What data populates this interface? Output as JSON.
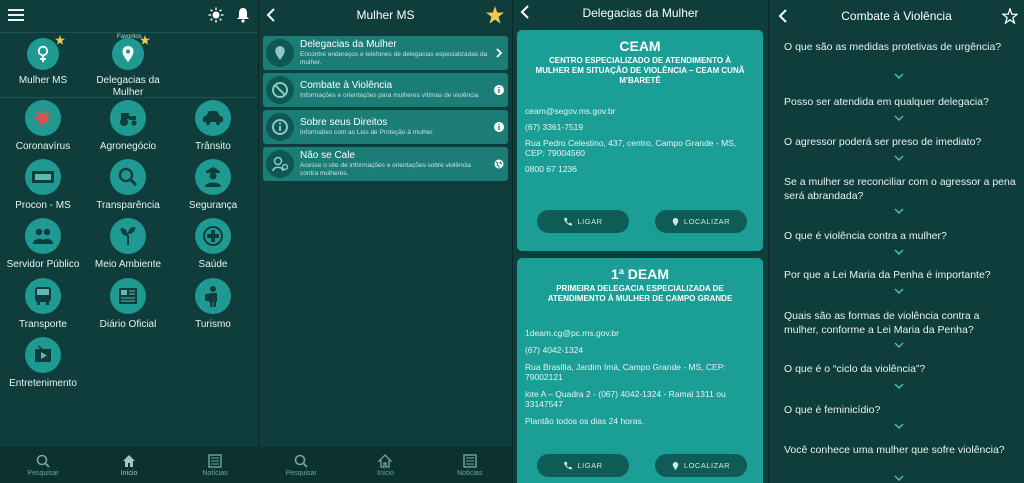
{
  "panel1": {
    "favorites_label": "Favoritos",
    "favorites": [
      {
        "label": "Mulher MS",
        "icon": "female-symbol-icon"
      },
      {
        "label": "Delegacias da Mulher",
        "icon": "location-pin-icon"
      }
    ],
    "tiles": [
      {
        "label": "Coronavírus",
        "icon": "virus-icon"
      },
      {
        "label": "Agronegócio",
        "icon": "tractor-icon"
      },
      {
        "label": "Trânsito",
        "icon": "car-icon"
      },
      {
        "label": "Procon - MS",
        "icon": "procon-icon"
      },
      {
        "label": "Transparência",
        "icon": "magnifier-icon"
      },
      {
        "label": "Segurança",
        "icon": "police-icon"
      },
      {
        "label": "Servidor Público",
        "icon": "people-icon"
      },
      {
        "label": "Meio Ambiente",
        "icon": "plant-icon"
      },
      {
        "label": "Saúde",
        "icon": "health-cross-icon"
      },
      {
        "label": "Transporte",
        "icon": "bus-icon"
      },
      {
        "label": "Diário Oficial",
        "icon": "newspaper-icon"
      },
      {
        "label": "Turismo",
        "icon": "tourist-icon"
      },
      {
        "label": "Entretenimento",
        "icon": "entertainment-icon"
      }
    ]
  },
  "nav": {
    "search": "Pesquisar",
    "home": "Início",
    "news": "Notícias"
  },
  "panel2": {
    "title": "Mulher MS",
    "items": [
      {
        "title": "Delegacias da Mulher",
        "desc": "Encontre endereços e telefones de delegacias especializadas da mulher."
      },
      {
        "title": "Combate à Violência",
        "desc": "Informações e orientações para mulheres vítimas de violência"
      },
      {
        "title": "Sobre seus Direitos",
        "desc": "Informativo com as Leis de Proteção à mulher."
      },
      {
        "title": "Não se Cale",
        "desc": "Acesse o site de informações e orientações sobre violência contra mulheres."
      }
    ]
  },
  "panel3": {
    "title": "Delegacias da Mulher",
    "cards": [
      {
        "name": "CEAM",
        "subtitle": "CENTRO ESPECIALIZADO DE ATENDIMENTO À MULHER EM SITUAÇÃO DE VIOLÊNCIA – CEAM CUNÃ M'BARETÊ",
        "email": "ceam@segov.ms.gov.br",
        "phone": "(67) 3361-7519",
        "address": "Rua Pedro Celestino, 437, centro, Campo Grande - MS, CEP: 79004560",
        "extra": "0800 67 1236",
        "extra2": "",
        "call": "LIGAR",
        "locate": "LOCALIZAR"
      },
      {
        "name": "1ª DEAM",
        "subtitle": "PRIMEIRA DELEGACIA ESPECIALIZADA DE ATENDIMENTO À MULHER DE CAMPO GRANDE",
        "email": "1deam.cg@pc.ms.gov.br",
        "phone": "(67) 4042-1324",
        "address": "Rua Brasília, Jardim Imá, Campo Grande - MS, CEP: 79002121",
        "extra": "lote A – Quadra 2 - (067) 4042-1324 - Ramal 1311 ou 33147547",
        "extra2": "Plantão todos os dias 24 horas.",
        "call": "LIGAR",
        "locate": "LOCALIZAR"
      }
    ]
  },
  "panel4": {
    "title": "Combate à Violência",
    "questions": [
      "O que são as medidas protetivas de urgência?",
      "Posso ser atendida em qualquer delegacia?",
      "O agressor poderá ser preso de imediato?",
      "Se a mulher se reconciliar com o agressor a pena será abrandada?",
      "O que é violência contra a mulher?",
      "Por que a Lei Maria da Penha é importante?",
      "Quais são as formas de violência contra a mulher, conforme a Lei Maria da Penha?",
      "O que é o “ciclo da violência”?",
      "O que é feminicídio?",
      "Você conhece uma mulher que sofre violência?"
    ]
  },
  "colors": {
    "accent": "#1f9a93",
    "background": "#0e3d3b",
    "star": "#f2c94c"
  }
}
